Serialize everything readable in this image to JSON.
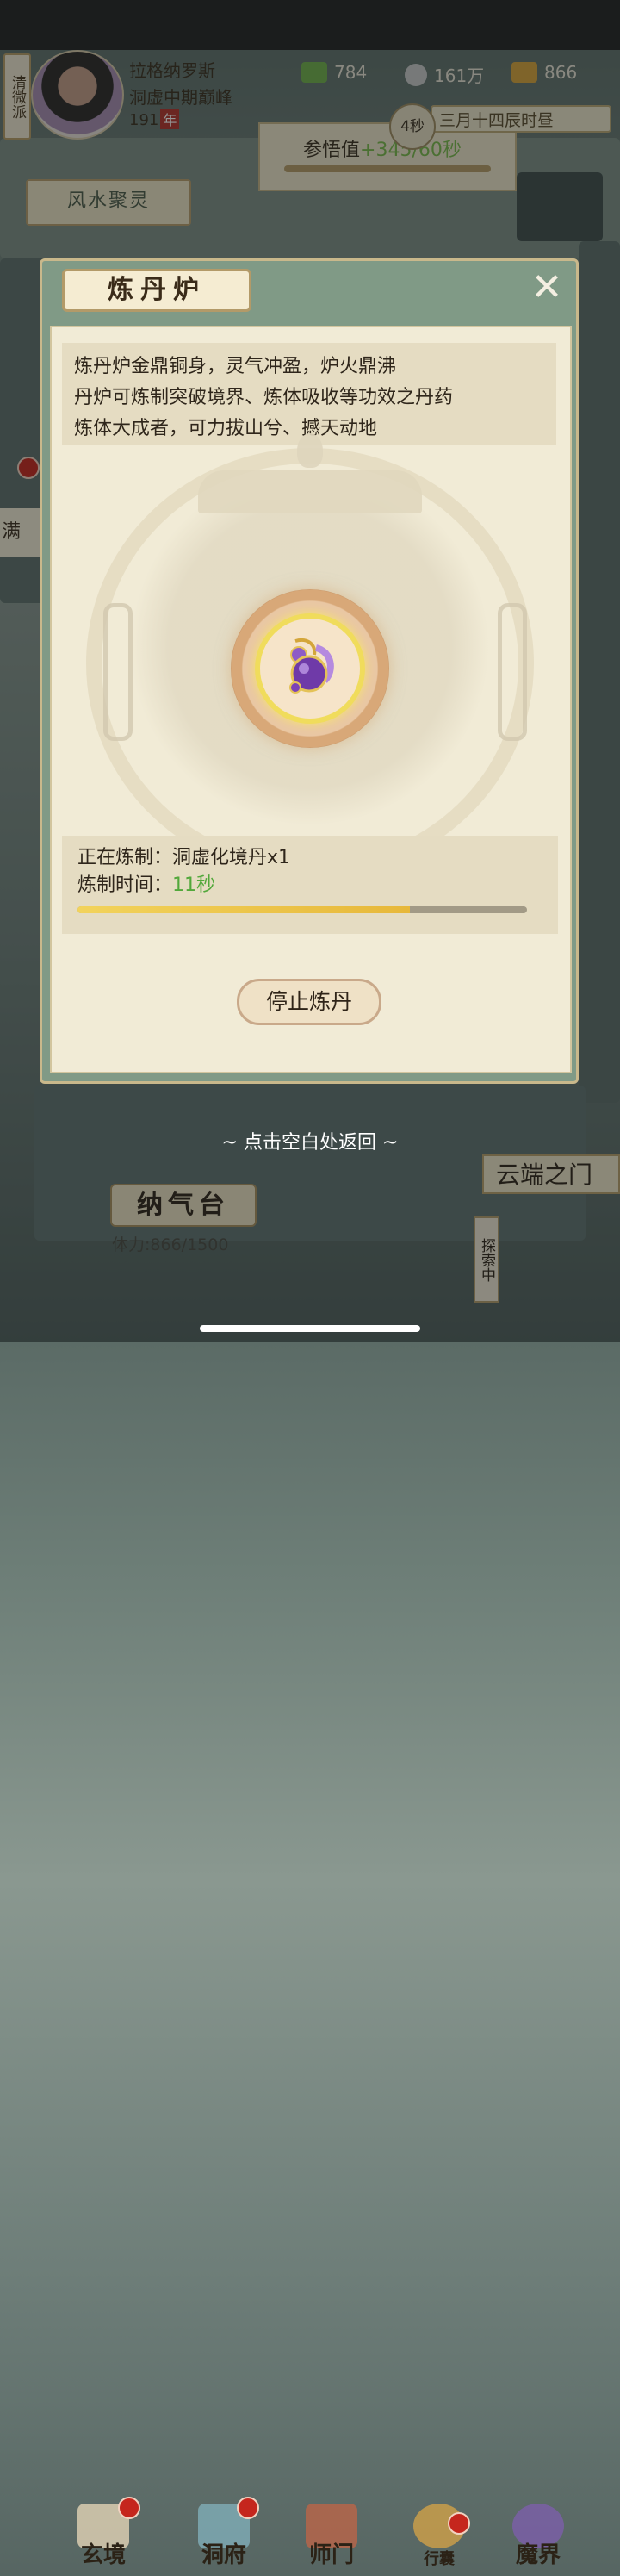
{
  "player": {
    "sect": "清微派",
    "name": "拉格纳罗斯",
    "realm": "洞虚中期巅峰",
    "age": "191",
    "age_unit": "年"
  },
  "resources": [
    {
      "icon": "jade-icon",
      "value": "784"
    },
    {
      "icon": "coin-icon",
      "value": "161万"
    },
    {
      "icon": "strength-icon",
      "value": "866"
    }
  ],
  "clock": {
    "timer": "4秒",
    "date_text": "三月十四辰时昼"
  },
  "background": {
    "insight_label": "参悟值",
    "insight_value": "+345/60秒",
    "fengshui": "风水聚灵",
    "left_tag": "满",
    "cloud_gate": "云端之门",
    "naqi": "纳气台",
    "stamina": "体力:866/1500",
    "explore": "探索中"
  },
  "modal": {
    "title": "炼丹炉",
    "close_icon": "close-icon",
    "description": [
      "炼丹炉金鼎铜身，灵气冲盈，炉火鼎沸",
      "丹炉可炼制突破境界、炼体吸收等功效之丹药",
      "炼体大成者，可力拔山兮、撼天动地"
    ],
    "crafting_label": "正在炼制：",
    "crafting_item": "洞虚化境丹x1",
    "time_label": "炼制时间：",
    "time_value": "11秒",
    "progress": 0.74,
    "stop_button": "停止炼丹"
  },
  "hint": "点击空白处返回",
  "nav": [
    {
      "label": "玄境",
      "icon": "scroll-icon"
    },
    {
      "label": "洞府",
      "icon": "lantern-icon"
    },
    {
      "label": "师门",
      "icon": "banner-icon"
    },
    {
      "label": "行囊",
      "icon": "bag-icon"
    },
    {
      "label": "魔界",
      "icon": "demon-icon"
    }
  ],
  "colors": {
    "accent_green": "#52a83b",
    "progress": "#f2d35c",
    "panel": "#f1ebd6",
    "frame": "#809a86"
  }
}
